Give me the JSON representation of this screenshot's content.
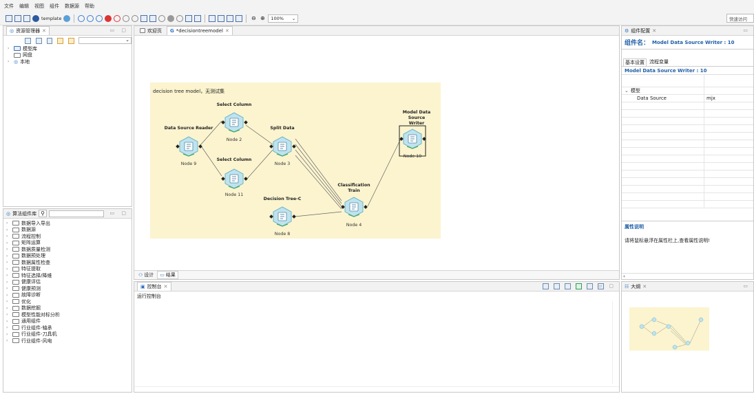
{
  "menu": [
    "文件",
    "编辑",
    "视图",
    "组件",
    "数据源",
    "帮助"
  ],
  "toolbar": {
    "template_label": "template",
    "zoom_value": "100%"
  },
  "quick_access": "快速访问",
  "left_top_panel": {
    "title": "资源管理器",
    "tree": [
      {
        "label": "模型库",
        "expandable": true
      },
      {
        "label": "网盘",
        "expandable": false
      },
      {
        "label": "本地",
        "expandable": true
      }
    ]
  },
  "left_bottom_panel": {
    "title": "算法组件库",
    "categories": [
      "数据导入导出",
      "数据源",
      "流程控制",
      "矩阵运算",
      "数据质量检测",
      "数据预处理",
      "数据属性检查",
      "特征提取",
      "特征选择/降维",
      "健康评估",
      "健康预测",
      "故障诊断",
      "优化",
      "数据挖掘",
      "模型性能对标分析",
      "通用组件",
      "行业组件-轴承",
      "行业组件-刀具机",
      "行业组件-风电"
    ]
  },
  "editor": {
    "tabs": [
      "欢迎页",
      "*decisiontreemodel"
    ],
    "canvas_title": "decision tree model，无测试集",
    "nodes": [
      {
        "title": "Data Source Reader",
        "label": "Node 9"
      },
      {
        "title": "Select Column",
        "label": "Node 2"
      },
      {
        "title": "Select Column",
        "label": "Node 11"
      },
      {
        "title": "Split Data",
        "label": "Node 3"
      },
      {
        "title": "Decision Tree-C",
        "label": "Node 8"
      },
      {
        "title": "Classification Train",
        "label": "Node 4"
      },
      {
        "title": "Model Data Source Writer",
        "label": "Node 10"
      }
    ],
    "bottom_tabs": [
      "设计",
      "结果"
    ]
  },
  "console": {
    "title": "控制台",
    "subtitle": "运行控制台"
  },
  "config_panel": {
    "title": "组件配置",
    "component_name_label": "组件名：",
    "component_name": "Model Data Source Writer : 10",
    "tabs": [
      "基本设置",
      "流程变量"
    ],
    "section_title": "Model Data Source Writer : 10",
    "group": "模型",
    "properties": [
      {
        "name": "Data Source",
        "value": "mjx"
      }
    ],
    "desc_title": "属性说明",
    "desc_text": "请将鼠标悬浮在属性栏上,查看属性说明!"
  },
  "outline_panel": {
    "title": "大纲"
  },
  "colors": {
    "accent": "#1f5fa8",
    "canvas_bg": "#fbf4cf",
    "node_fill": "#bfe3ee",
    "node_edge": "#6eb6c9"
  }
}
